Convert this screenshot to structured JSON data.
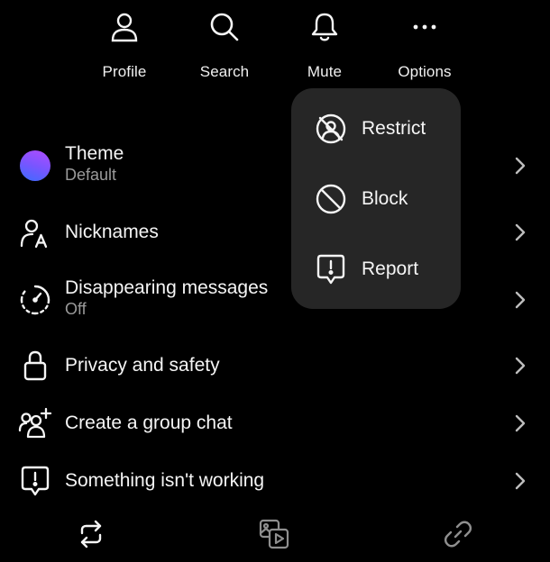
{
  "colors": {
    "background": "#000000",
    "menu_background": "#262626",
    "text_primary": "#f5f5f5",
    "text_secondary": "#9a9a9a",
    "theme_gradient_start": "#3b6cff",
    "theme_gradient_end": "#b14bff"
  },
  "top_actions": [
    {
      "label": "Profile",
      "icon": "person-icon"
    },
    {
      "label": "Search",
      "icon": "search-icon"
    },
    {
      "label": "Mute",
      "icon": "bell-icon"
    },
    {
      "label": "Options",
      "icon": "more-horizontal-icon"
    }
  ],
  "options_menu": {
    "items": [
      {
        "label": "Restrict",
        "icon": "restrict-icon"
      },
      {
        "label": "Block",
        "icon": "block-icon"
      },
      {
        "label": "Report",
        "icon": "report-icon"
      }
    ]
  },
  "settings": [
    {
      "title": "Theme",
      "subtitle": "Default",
      "icon": "theme-color-icon"
    },
    {
      "title": "Nicknames",
      "subtitle": "",
      "icon": "nickname-icon"
    },
    {
      "title": "Disappearing messages",
      "subtitle": "Off",
      "icon": "disappearing-timer-icon"
    },
    {
      "title": "Privacy and safety",
      "subtitle": "",
      "icon": "lock-icon"
    },
    {
      "title": "Create a group chat",
      "subtitle": "",
      "icon": "add-people-icon"
    },
    {
      "title": "Something isn't working",
      "subtitle": "",
      "icon": "report-icon"
    }
  ],
  "bottom_bar": [
    {
      "icon": "repeat-icon"
    },
    {
      "icon": "media-icon"
    },
    {
      "icon": "link-icon"
    }
  ]
}
